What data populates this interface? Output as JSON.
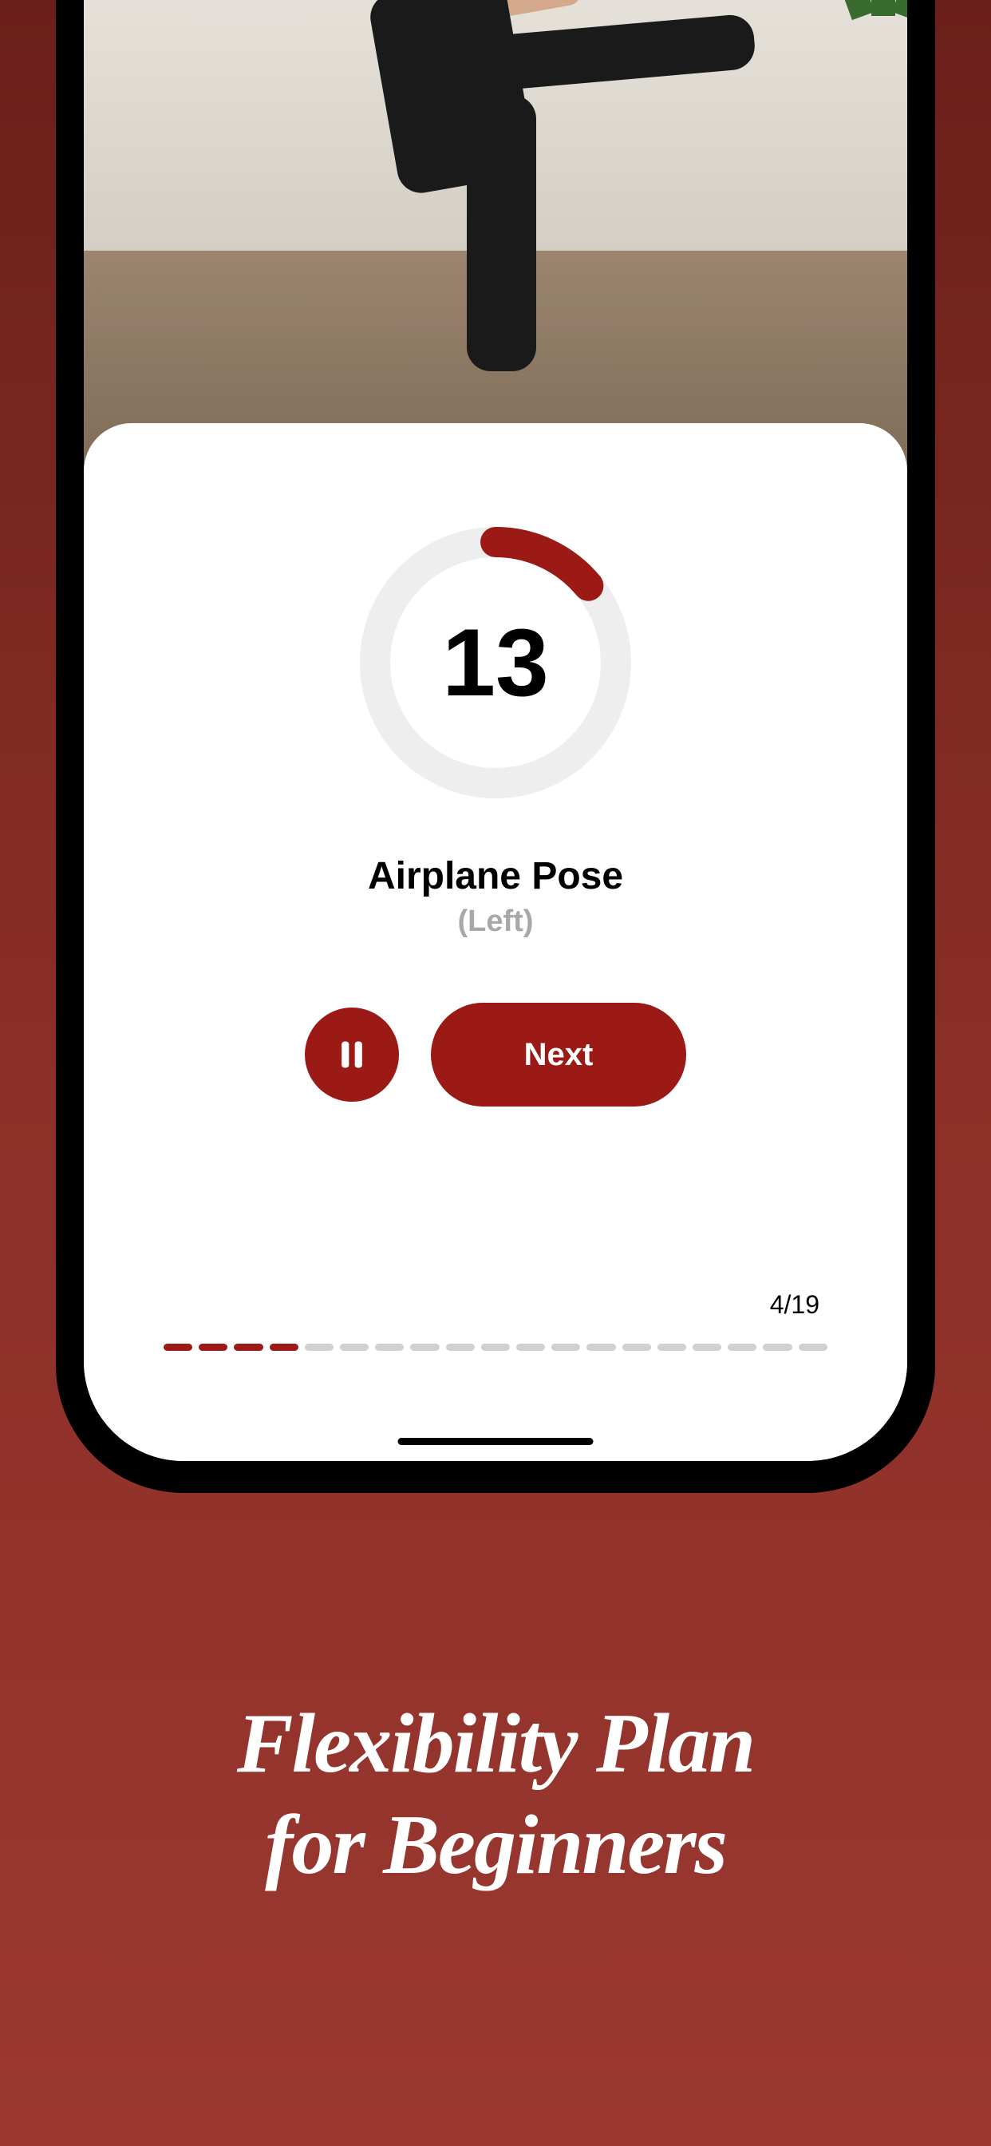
{
  "timer": {
    "seconds_remaining": "13",
    "progress_fraction": 0.14
  },
  "exercise": {
    "name": "Airplane Pose",
    "side": "(Left)"
  },
  "controls": {
    "next_label": "Next"
  },
  "progress": {
    "current_step": 4,
    "total_steps": 19,
    "counter_text": "4/19"
  },
  "marketing": {
    "line1": "Flexibility Plan",
    "line2": "for Beginners"
  },
  "colors": {
    "accent": "#9c1a15",
    "muted": "#a8a8a8"
  }
}
